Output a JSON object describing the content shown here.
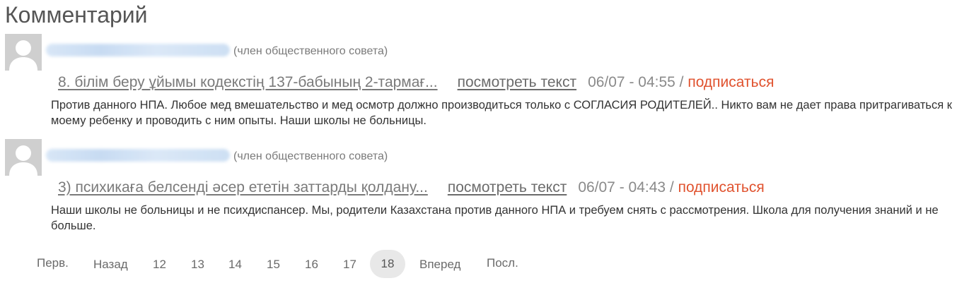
{
  "page": {
    "title": "Комментарий"
  },
  "comments": [
    {
      "author_role": "(член общественного совета)",
      "npa_title": "8. білім беру ұйымы кодекстің 137-бабының 2-тармағ...",
      "view_text": "посмотреть текст",
      "timestamp": "06/07 - 04:55 /",
      "subscribe": "подписаться",
      "body": "Против данного НПА. Любое мед вмешательство и мед осмотр должно производиться только с СОГЛАСИЯ РОДИТЕЛЕЙ.. Никто вам не дает права притрагиваться к моему ребенку и проводить с ним опыты. Наши школы не больницы."
    },
    {
      "author_role": "(член общественного совета)",
      "npa_title": "3) психикаға белсенді әсер ететін заттарды қолдану...",
      "view_text": "посмотреть текст",
      "timestamp": "06/07 - 04:43 /",
      "subscribe": "подписаться",
      "body": "Наши школы не больницы и не психдиспансер. Мы, родители Казахстана против данного НПА и требуем снять с рассмотрения. Школа для получения знаний и не больше."
    }
  ],
  "pager": {
    "first": "Перв.",
    "prev": "Назад",
    "pages": [
      "12",
      "13",
      "14",
      "15",
      "16",
      "17",
      "18"
    ],
    "current": "18",
    "next": "Вперед",
    "last": "Посл."
  },
  "colors": {
    "subscribe": "#e0522e",
    "avatar_bg": "#cfcfcf",
    "current_page_bg": "#e8e8e8"
  },
  "icons": {
    "avatar": "default-user-silhouette-icon"
  }
}
